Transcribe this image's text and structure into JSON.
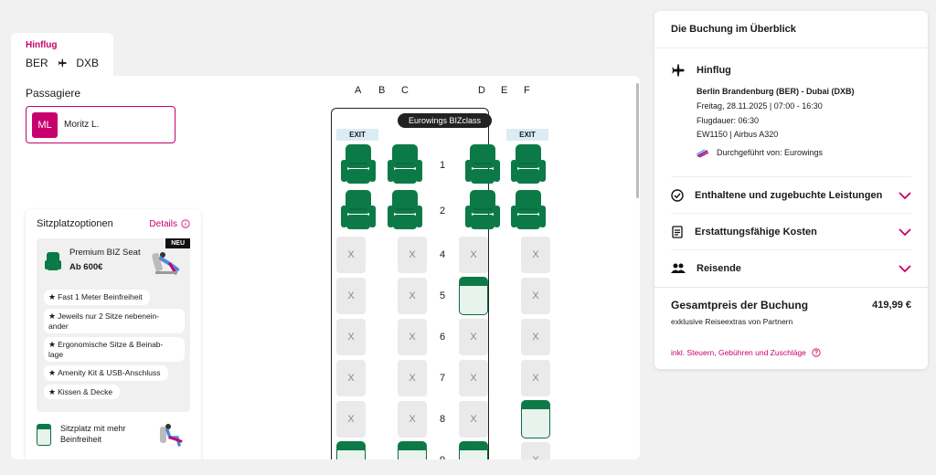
{
  "flight_tab": {
    "label": "Hinflug",
    "from": "BER",
    "to": "DXB"
  },
  "passengers": {
    "title": "Passagiere",
    "initials": "ML",
    "name": "Moritz L."
  },
  "options": {
    "title": "Sitzplatzoptionen",
    "details_label": "Details",
    "premium": {
      "badge": "NEU",
      "name": "Premium BIZ Seat",
      "price": "Ab 600€",
      "features": [
        "Fast 1 Meter Beinfreiheit",
        "Jeweils nur 2 Sitze nebenein-ander",
        "Ergonomische Sitze & Beinab-lage",
        "Amenity Kit & USB-Anschluss",
        "Kissen & Decke"
      ]
    },
    "legroom_label": "Sitzplatz mit mehr Beinfreiheit"
  },
  "seatmap": {
    "columns": [
      "A",
      "B",
      "C",
      "D",
      "E",
      "F"
    ],
    "aircraft_label": "Eurowings BIZclass",
    "exit_label": "EXIT",
    "rows": [
      "1",
      "2",
      "4",
      "5",
      "6",
      "7",
      "8",
      "9"
    ],
    "seat_x_label": "X"
  },
  "summary": {
    "title": "Die Buchung im Überblick",
    "flight": {
      "label": "Hinflug",
      "route": "Berlin Brandenburg (BER) - Dubai (DXB)",
      "date": "Freitag, 28.11.2025 | 07:00 - 16:30",
      "duration": "Flugdauer: 06:30",
      "flight_no": "EW1150 | Airbus A320",
      "operated_by": "Durchgeführt von: Eurowings"
    },
    "sections": [
      {
        "label": "Enthaltene und zugebuchte Leistungen",
        "icon": "check-circle-icon"
      },
      {
        "label": "Erstattungsfähige Kosten",
        "icon": "document-icon"
      },
      {
        "label": "Reisende",
        "icon": "people-icon"
      }
    ],
    "total_label": "Gesamtpreis der Buchung",
    "total_price": "419,99 €",
    "total_sub": "exklusive Reiseextras von Partnern",
    "tax_link": "inkl. Steuern, Gebühren und Zuschläge"
  },
  "colors": {
    "accent": "#c8006e",
    "seat_green": "#0c7a47",
    "exit_bg": "#dcecf5"
  }
}
